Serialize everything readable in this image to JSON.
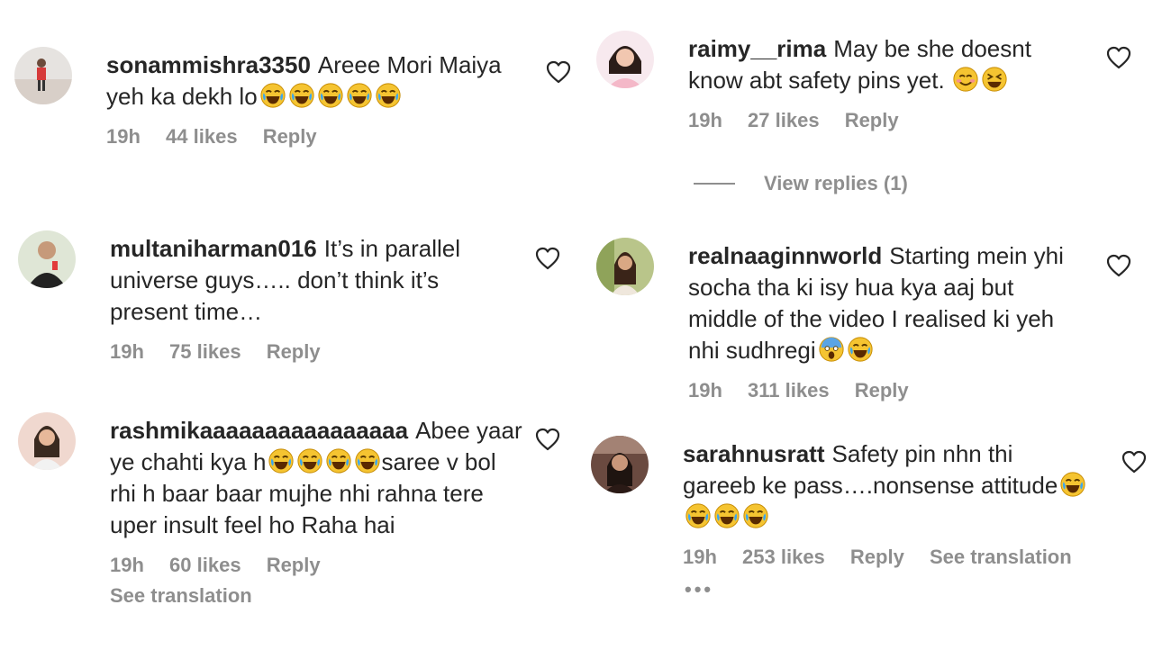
{
  "comments": [
    {
      "username": "sonammishra3350",
      "text": "Areee Mori Maiya yeh ka dekh lo",
      "emoji": [
        "😂",
        "😂",
        "😂",
        "😂",
        "😂"
      ],
      "time": "19h",
      "likes": "44 likes",
      "reply": "Reply"
    },
    {
      "username": "multaniharman016",
      "text": "It’s in parallel universe guys….. don’t think it’s present time…",
      "time": "19h",
      "likes": "75 likes",
      "reply": "Reply"
    },
    {
      "username": "rashmikaaaaaaaaaaaaaaaa",
      "text_a": "Abee yaar ye chahti kya h",
      "emoji": [
        "😂",
        "😂",
        "😂",
        "😂"
      ],
      "text_b": "saree v bol rhi h baar baar mujhe nhi rahna tere uper insult feel ho Raha hai",
      "time": "19h",
      "likes": "60 likes",
      "reply": "Reply",
      "see_translation": "See translation"
    },
    {
      "username": "raimy__rima",
      "text": "May be she doesnt know abt safety pins yet.",
      "emoji": [
        "😊",
        "😆"
      ],
      "time": "19h",
      "likes": "27 likes",
      "reply": "Reply",
      "view_replies": "View replies (1)"
    },
    {
      "username": "realnaaginnworld",
      "text": "Starting mein yhi socha tha ki isy hua kya aaj but middle of the video I realised ki yeh nhi sudhregi",
      "emoji": [
        "😱",
        "😂"
      ],
      "time": "19h",
      "likes": "311 likes",
      "reply": "Reply"
    },
    {
      "username": "sarahnusratt",
      "text": "Safety pin nhn thi gareeb ke pass….nonsense attitude",
      "emoji": [
        "😂",
        "😂",
        "😂",
        "😂"
      ],
      "time": "19h",
      "likes": "253 likes",
      "reply": "Reply",
      "see_translation": "See translation",
      "more": "•••"
    }
  ],
  "icons": {
    "like": "heart-outline-icon",
    "emoji_laugh": "face-with-tears-of-joy-icon"
  },
  "colors": {
    "text": "#262626",
    "muted": "#8e8e8e",
    "emoji_face": "#f5c431"
  }
}
